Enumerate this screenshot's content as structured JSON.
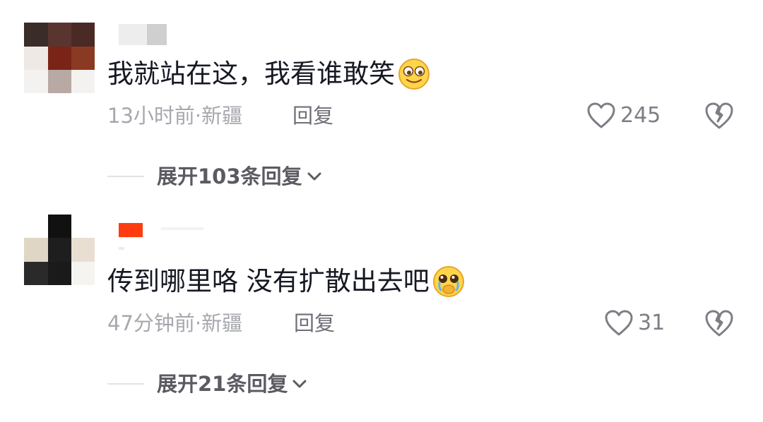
{
  "comments": [
    {
      "text": "我就站在这，我看谁敢笑",
      "emoji_icon": "smiling-eyes-emoji-icon",
      "time_location": "13小时前·新疆",
      "reply_label": "回复",
      "likes": "245",
      "expand_label": "展开103条回复"
    },
    {
      "text": "传到哪里咯 没有扩散出去吧",
      "emoji_icon": "pleading-face-emoji-icon",
      "time_location": "47分钟前·新疆",
      "reply_label": "回复",
      "likes": "31",
      "expand_label": "展开21条回复"
    }
  ],
  "colors": {
    "text_primary": "#161823",
    "text_meta": "#a7a8ae",
    "reply": "#6e6f76",
    "icon": "#7d7e85",
    "username_badge": "#fe3c10"
  }
}
